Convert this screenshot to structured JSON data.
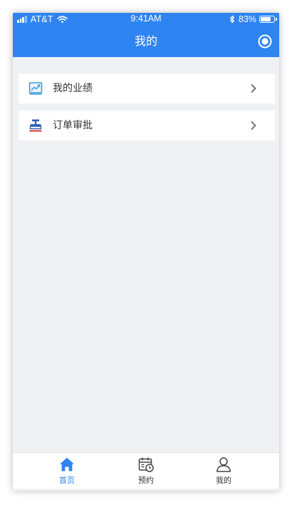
{
  "colors": {
    "primary": "#2e84f0",
    "background": "#f0f1f5",
    "text": "#333333"
  },
  "status_bar": {
    "carrier": "AT&T",
    "time": "9:41AM",
    "battery_percent": "83%",
    "battery_level": 0.83,
    "icons": [
      "signal-icon",
      "wifi-icon",
      "bluetooth-icon",
      "battery-icon"
    ]
  },
  "header": {
    "title": "我的",
    "action_icon": "record-icon"
  },
  "menu": [
    {
      "label": "我的业绩",
      "icon": "performance-chart-icon"
    },
    {
      "label": "订单审批",
      "icon": "stamp-icon"
    }
  ],
  "tabbar": {
    "active": 0,
    "tabs": [
      {
        "label": "首页",
        "icon": "home-icon"
      },
      {
        "label": "预约",
        "icon": "calendar-clock-icon"
      },
      {
        "label": "我的",
        "icon": "user-icon"
      }
    ]
  }
}
